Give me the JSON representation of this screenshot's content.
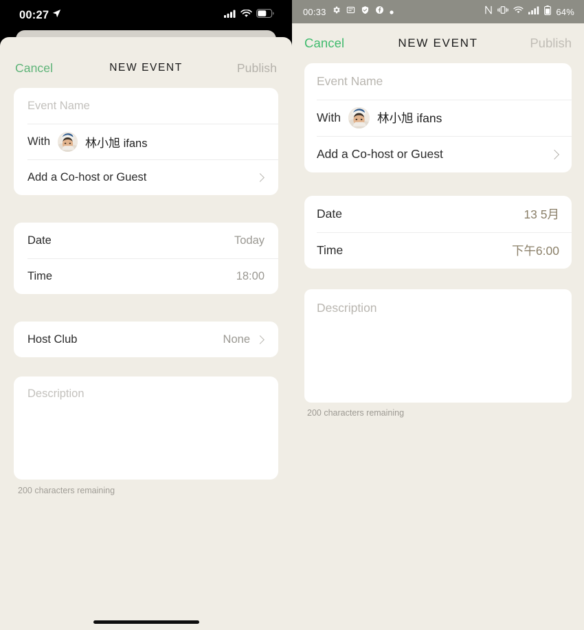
{
  "ios": {
    "status_bar": {
      "time": "00:27",
      "location_icon": "location-arrow-icon",
      "cellular_icon": "cellular-signal-icon",
      "wifi_icon": "wifi-icon",
      "battery_icon": "battery-icon"
    },
    "nav": {
      "cancel_label": "Cancel",
      "title": "NEW EVENT",
      "publish_label": "Publish"
    },
    "event_card": {
      "name_placeholder": "Event Name",
      "with_label": "With",
      "host_name_cjk": "林小旭",
      "host_name_latin": "ifans",
      "add_guest_label": "Add a Co-host or Guest",
      "add_guest_chevron": "chevron-right-icon"
    },
    "date_card": {
      "date_label": "Date",
      "date_value": "Today",
      "time_label": "Time",
      "time_value": "18:00"
    },
    "club_card": {
      "label": "Host Club",
      "value": "None",
      "chevron": "chevron-right-icon"
    },
    "description": {
      "placeholder": "Description",
      "counter": "200 characters remaining"
    },
    "home_indicator": "home-indicator"
  },
  "android": {
    "status_bar": {
      "time": "00:33",
      "left_icons": [
        "gear-icon",
        "message-icon",
        "shield-icon",
        "facebook-icon",
        "dot-icon"
      ],
      "right_icons": [
        "nfc-icon",
        "vibrate-icon",
        "wifi-icon",
        "cellular-signal-icon",
        "battery-icon"
      ],
      "battery_percent": "64%"
    },
    "nav": {
      "cancel_label": "Cancel",
      "title": "NEW EVENT",
      "publish_label": "Publish"
    },
    "event_card": {
      "name_placeholder": "Event Name",
      "with_label": "With",
      "host_name_cjk": "林小旭",
      "host_name_latin": "ifans",
      "add_guest_label": "Add a Co-host or Guest",
      "add_guest_chevron": "chevron-right-icon"
    },
    "date_card": {
      "date_label": "Date",
      "date_value": "13 5月",
      "time_label": "Time",
      "time_value": "下午6:00"
    },
    "description": {
      "placeholder": "Description",
      "counter": "200 characters remaining"
    }
  },
  "colors": {
    "background": "#f0ede5",
    "sheet_back": "#d4d1ca",
    "card": "#ffffff",
    "accent_green_ios": "#5eb478",
    "accent_green_android": "#3fbb6d",
    "disabled_text": "#b5b2ab",
    "date_value_android": "#8a7f68",
    "android_status_bar": "#8d8d85"
  }
}
